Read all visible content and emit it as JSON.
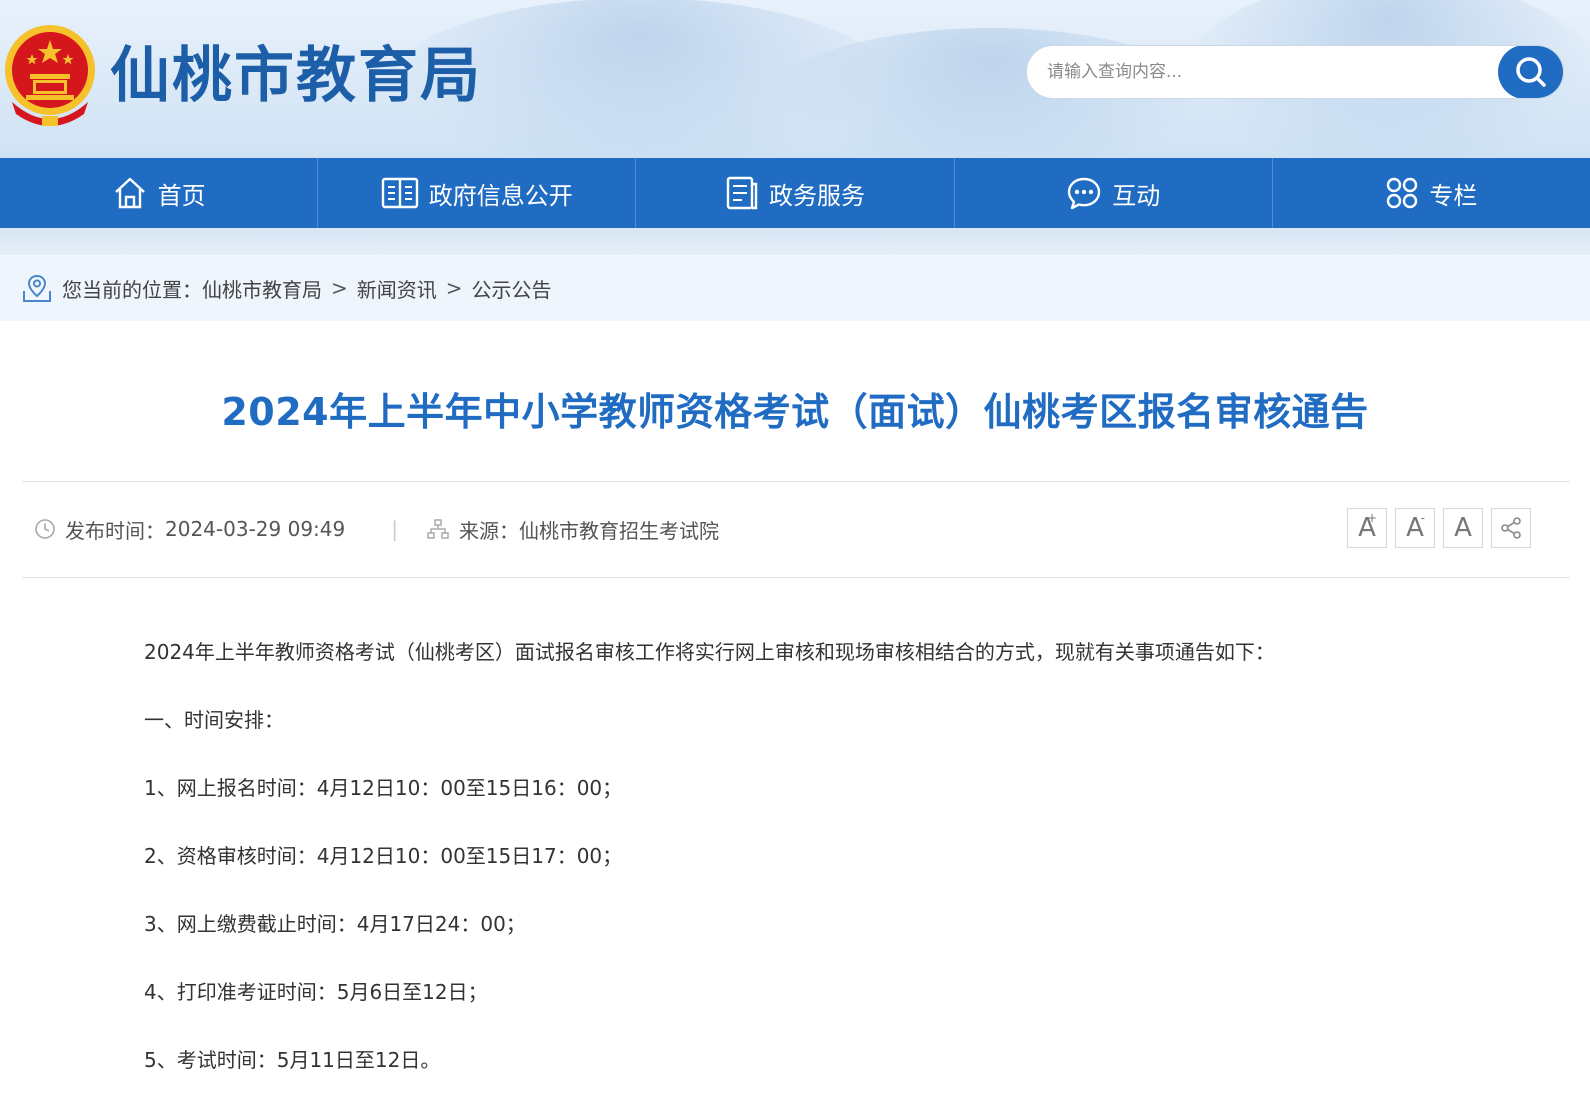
{
  "header": {
    "site_title": "仙桃市教育局",
    "search": {
      "placeholder": "请输入查询内容..."
    }
  },
  "nav": {
    "items": [
      {
        "label": "首页",
        "icon": "home-icon"
      },
      {
        "label": "政府信息公开",
        "icon": "open-book-icon"
      },
      {
        "label": "政务服务",
        "icon": "document-list-icon"
      },
      {
        "label": "互动",
        "icon": "chat-bubble-icon"
      },
      {
        "label": "专栏",
        "icon": "grid-clover-icon"
      }
    ]
  },
  "breadcrumb": {
    "prefix": "您当前的位置：",
    "items": [
      "仙桃市教育局",
      "新闻资讯",
      "公示公告"
    ],
    "separator": ">"
  },
  "article": {
    "title": "2024年上半年中小学教师资格考试（面试）仙桃考区报名审核通告",
    "publish_label": "发布时间：",
    "publish_time": "2024-03-29 09:49",
    "meta_divider": "|",
    "source_label": "来源：",
    "source": "仙桃市教育招生考试院",
    "tools": [
      {
        "label": "A",
        "mark": "+",
        "icon": "font-increase-icon"
      },
      {
        "label": "A",
        "mark": "-",
        "icon": "font-decrease-icon"
      },
      {
        "label": "A",
        "mark": "",
        "icon": "font-reset-icon"
      },
      {
        "label": "",
        "mark": "",
        "icon": "share-icon"
      }
    ],
    "paragraphs": [
      "2024年上半年教师资格考试（仙桃考区）面试报名审核工作将实行网上审核和现场审核相结合的方式，现就有关事项通告如下：",
      "一、时间安排：",
      "1、网上报名时间：4月12日10：00至15日16：00；",
      "2、资格审核时间：4月12日10：00至15日17：00；",
      "3、网上缴费截止时间：4月17日24：00；",
      "4、打印准考证时间：5月6日至12日；",
      "5、考试时间：5月11日至12日。"
    ]
  },
  "colors": {
    "brand_blue": "#216cc3",
    "title_blue": "#1d5ea9",
    "emblem_red": "#d5161d",
    "emblem_gold": "#f6c22c"
  }
}
